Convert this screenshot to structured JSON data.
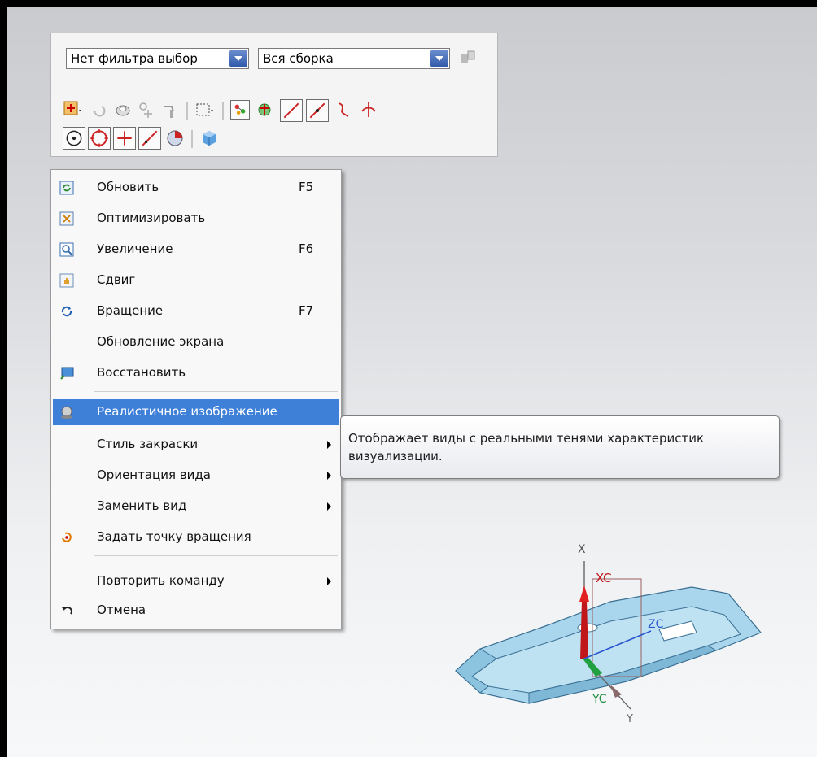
{
  "toolbar": {
    "filter_value": "Нет фильтра выбор",
    "scope_value": "Вся сборка",
    "row1_icons": [
      "selection-plus-icon",
      "arrow-icon",
      "shape-icon",
      "point-icon",
      "vertex-icon",
      "box-select-icon",
      "snap-icon",
      "rotate-icon",
      "line-icon",
      "line-point-icon",
      "curve-icon",
      "axis-icon"
    ],
    "row2_icons": [
      "circle-center-icon",
      "circle-icon",
      "cross-icon",
      "tangent-line-icon",
      "pie-icon",
      "cube-icon"
    ]
  },
  "menu": {
    "items": [
      {
        "label": "Обновить",
        "shortcut": "F5",
        "icon": "refresh-icon"
      },
      {
        "label": "Оптимизировать",
        "shortcut": "",
        "icon": "fit-icon"
      },
      {
        "label": "Увеличение",
        "shortcut": "F6",
        "icon": "zoom-icon"
      },
      {
        "label": "Сдвиг",
        "shortcut": "",
        "icon": "pan-icon"
      },
      {
        "label": "Вращение",
        "shortcut": "F7",
        "icon": "rotate-icon"
      },
      {
        "label": "Обновление экрана",
        "shortcut": "",
        "icon": ""
      },
      {
        "label": "Восстановить",
        "shortcut": "",
        "icon": "restore-icon"
      },
      {
        "label": "Реалистичное изображение",
        "shortcut": "",
        "icon": "sphere-icon"
      },
      {
        "label": "Стиль закраски",
        "shortcut": "",
        "icon": ""
      },
      {
        "label": "Ориентация вида",
        "shortcut": "",
        "icon": ""
      },
      {
        "label": "Заменить вид",
        "shortcut": "",
        "icon": ""
      },
      {
        "label": "Задать точку вращения",
        "shortcut": "",
        "icon": "rotation-point-icon"
      },
      {
        "label": "Повторить команду",
        "shortcut": "",
        "icon": ""
      },
      {
        "label": "Отмена",
        "shortcut": "",
        "icon": "undo-icon"
      }
    ]
  },
  "tooltip": {
    "line1": "Отображает виды с реальными тенями характеристик",
    "line2": "визуализации."
  },
  "axes": {
    "x": "X",
    "xc": "XC",
    "zc": "ZC",
    "yc": "YC",
    "y": "Y"
  },
  "colors": {
    "accent": "#3e7fd8",
    "part": "#a9d6ec",
    "part_edge": "#3a6f94"
  }
}
